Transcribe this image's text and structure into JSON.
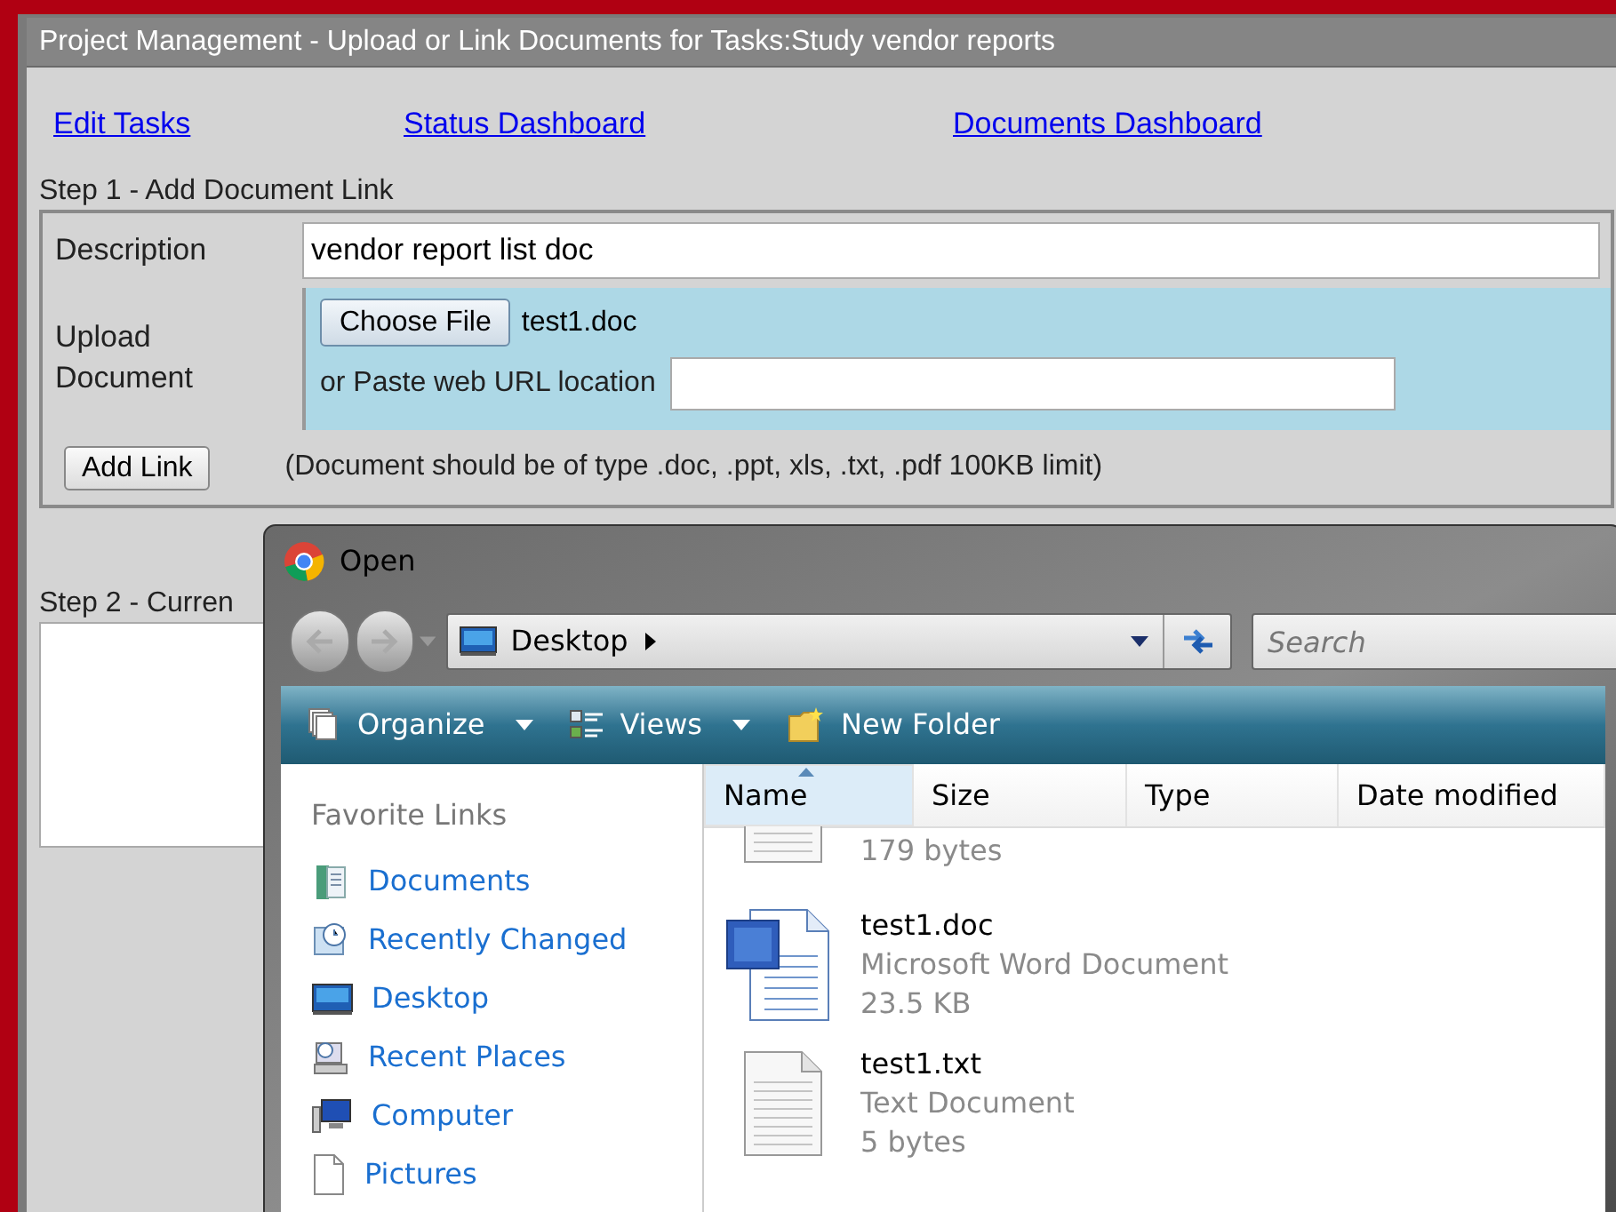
{
  "window": {
    "title": "Project Management - Upload or Link Documents for Tasks:Study vendor reports"
  },
  "nav_links": [
    {
      "label": "Edit Tasks"
    },
    {
      "label": "Status Dashboard"
    },
    {
      "label": "Documents Dashboard"
    }
  ],
  "step1": {
    "heading": "Step 1 - Add Document Link",
    "description_label": "Description",
    "description_value": "vendor report list doc",
    "upload_label": "Upload Document",
    "choose_file_button": "Choose File",
    "chosen_file": "test1.doc",
    "url_label": "or Paste web URL location",
    "add_link_button": "Add Link",
    "note": "(Document should be of type .doc, .ppt, xls, .txt, .pdf 100KB limit)"
  },
  "step2": {
    "heading": "Step 2 - Curren"
  },
  "dialog": {
    "title": "Open",
    "address": "Desktop",
    "search_placeholder": "Search",
    "toolbar": [
      {
        "label": "Organize",
        "kind": "menu"
      },
      {
        "label": "Views",
        "kind": "menu"
      },
      {
        "label": "New Folder",
        "kind": "action"
      }
    ],
    "favorites_heading": "Favorite Links",
    "favorites": [
      {
        "label": "Documents",
        "kind": "documents"
      },
      {
        "label": "Recently Changed",
        "kind": "recent"
      },
      {
        "label": "Desktop",
        "kind": "desktop"
      },
      {
        "label": "Recent Places",
        "kind": "places"
      },
      {
        "label": "Computer",
        "kind": "computer"
      },
      {
        "label": "Pictures",
        "kind": "pictures"
      }
    ],
    "columns": [
      {
        "label": "Name",
        "sorted": true
      },
      {
        "label": "Size",
        "sorted": false
      },
      {
        "label": "Type",
        "sorted": false
      },
      {
        "label": "Date modified",
        "sorted": false
      }
    ],
    "files": [
      {
        "kind": "text",
        "size": "179 bytes"
      },
      {
        "kind": "word",
        "name": "test1.doc",
        "type": "Microsoft Word Document",
        "size": "23.5 KB"
      },
      {
        "kind": "text",
        "name": "test1.txt",
        "type": "Text Document",
        "size": "5 bytes"
      }
    ]
  }
}
